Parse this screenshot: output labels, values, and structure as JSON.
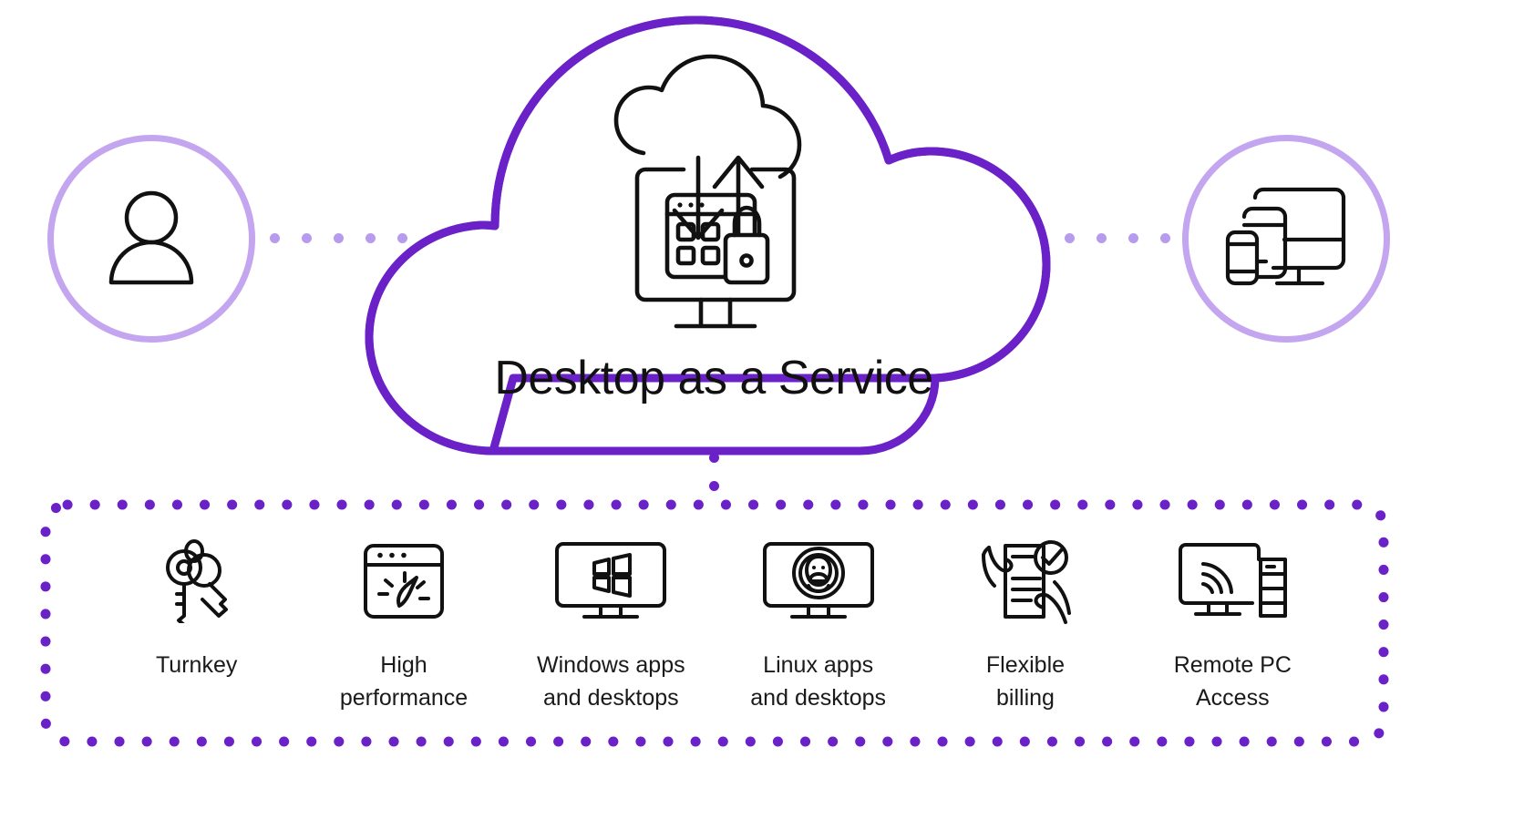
{
  "diagram": {
    "title": "Desktop as a Service",
    "colors": {
      "cloud_outline": "#6b21c8",
      "circle_ring": "#c4a5ef",
      "connector_dot_light": "#b79bec",
      "connector_dot_dark": "#6b21c8",
      "icon_stroke": "#111111",
      "text": "#1a1a1a",
      "background": "#ffffff"
    },
    "left_node": {
      "icon": "user-icon",
      "label": ""
    },
    "right_node": {
      "icon": "multi-device-icon",
      "label": ""
    },
    "center_node": {
      "icon": "cloud-sync-desktop-lock-icon",
      "label": "Desktop as a Service"
    },
    "connectors": {
      "left_dot_count": 5,
      "right_dot_count": 5,
      "vertical_dot_count": 2
    }
  },
  "features": [
    {
      "id": "turnkey",
      "icon": "keys-icon",
      "label": "Turnkey"
    },
    {
      "id": "high-performance",
      "icon": "speedometer-window-icon",
      "label": "High\nperformance"
    },
    {
      "id": "windows-apps",
      "icon": "windows-monitor-icon",
      "label": "Windows apps\nand desktops"
    },
    {
      "id": "linux-apps",
      "icon": "linux-penguin-monitor-icon",
      "label": "Linux apps\nand desktops"
    },
    {
      "id": "flexible-billing",
      "icon": "invoice-check-hands-icon",
      "label": "Flexible\nbilling"
    },
    {
      "id": "remote-pc-access",
      "icon": "monitor-wifi-server-icon",
      "label": "Remote PC\nAccess"
    }
  ]
}
